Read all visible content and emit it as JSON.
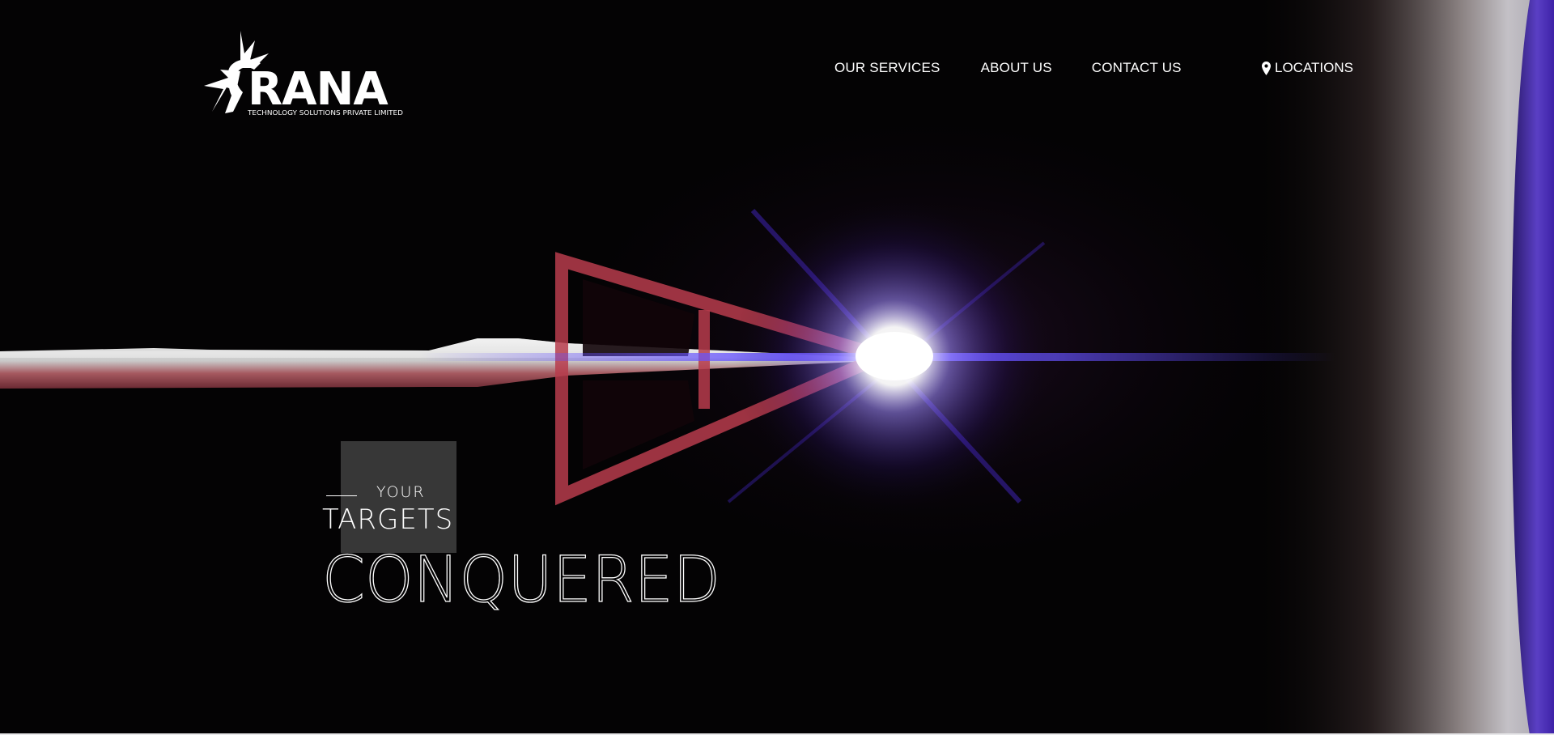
{
  "brand": {
    "name": "RANA",
    "tagline": "TECHNOLOGY SOLUTIONS PRIVATE LIMITED",
    "logo_icon": "starburst-icon",
    "accent_color": "#ffffff"
  },
  "nav": {
    "services": "OUR SERVICES",
    "about": "ABOUT US",
    "contact": "CONTACT US",
    "locations": "LOCATIONS",
    "locations_icon": "map-pin-icon"
  },
  "hero": {
    "line1": "YOUR",
    "line2": "TARGETS",
    "line3": "CONQUERED",
    "arrow_color": "#b73c4c",
    "glow_color": "#4a2bd8"
  }
}
